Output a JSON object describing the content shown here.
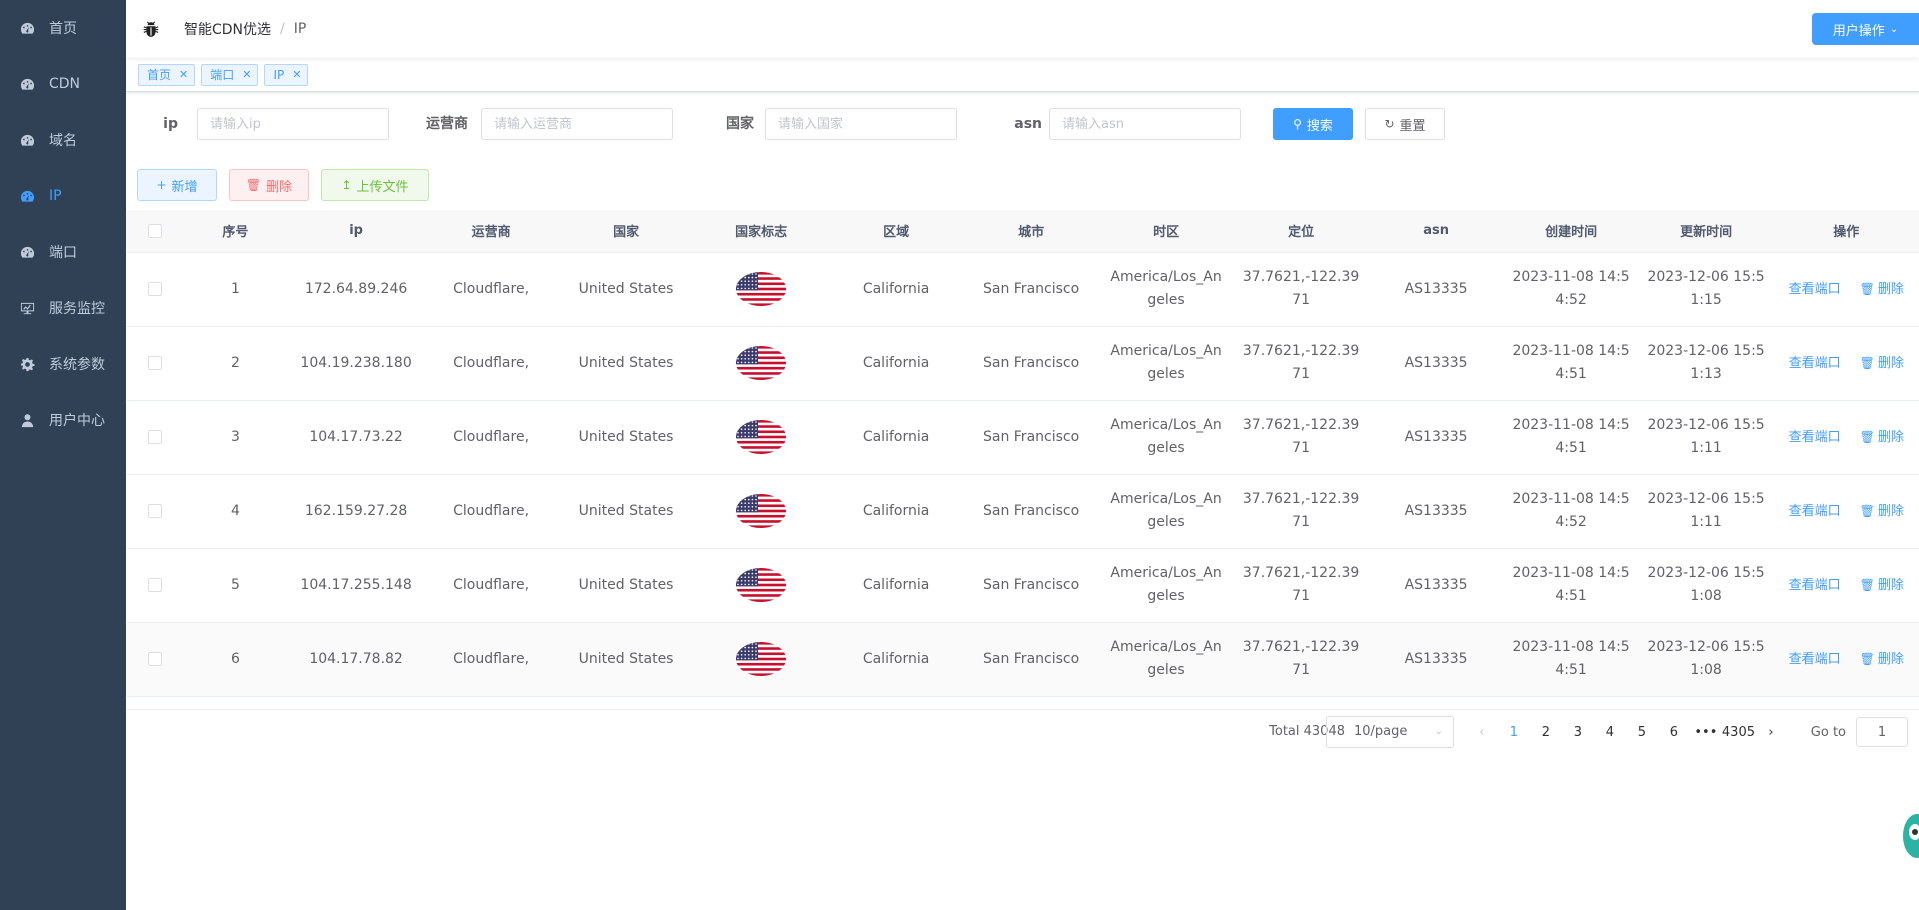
{
  "sidebar": {
    "items": [
      {
        "label": "首页",
        "icon": "dashboard-icon"
      },
      {
        "label": "CDN",
        "icon": "dashboard-icon"
      },
      {
        "label": "域名",
        "icon": "dashboard-icon"
      },
      {
        "label": "IP",
        "icon": "dashboard-icon",
        "active": true
      },
      {
        "label": "端口",
        "icon": "dashboard-icon"
      },
      {
        "label": "服务监控",
        "icon": "monitor-icon"
      },
      {
        "label": "系统参数",
        "icon": "gear-icon"
      },
      {
        "label": "用户中心",
        "icon": "user-icon"
      }
    ]
  },
  "navbar": {
    "breadcrumb": [
      "智能CDN优选",
      "IP"
    ],
    "user_menu": "用户操作"
  },
  "tags": [
    "首页",
    "端口",
    "IP"
  ],
  "filters": {
    "ip_label": "ip",
    "ip_placeholder": "请输入ip",
    "isp_label": "运营商",
    "isp_placeholder": "请输入运营商",
    "country_label": "国家",
    "country_placeholder": "请输入国家",
    "asn_label": "asn",
    "asn_placeholder": "请输入asn",
    "search": "搜索",
    "reset": "重置"
  },
  "actions": {
    "add": "新增",
    "delete": "删除",
    "upload": "上传文件"
  },
  "table": {
    "columns": [
      "序号",
      "ip",
      "运营商",
      "国家",
      "国家标志",
      "区域",
      "城市",
      "时区",
      "定位",
      "asn",
      "创建时间",
      "更新时间",
      "操作"
    ],
    "view_ports": "查看端口",
    "delete": "删除",
    "rows": [
      {
        "no": "1",
        "ip": "172.64.89.246",
        "isp": "Cloudflare,",
        "country": "United States",
        "region": "California",
        "city": "San Francisco",
        "tz1": "America/Los_An",
        "tz2": "geles",
        "loc1": "37.7621,-122.39",
        "loc2": "71",
        "asn": "AS13335",
        "c1": "2023-11-08 14:5",
        "c2": "4:52",
        "u1": "2023-12-06 15:5",
        "u2": "1:15"
      },
      {
        "no": "2",
        "ip": "104.19.238.180",
        "isp": "Cloudflare,",
        "country": "United States",
        "region": "California",
        "city": "San Francisco",
        "tz1": "America/Los_An",
        "tz2": "geles",
        "loc1": "37.7621,-122.39",
        "loc2": "71",
        "asn": "AS13335",
        "c1": "2023-11-08 14:5",
        "c2": "4:51",
        "u1": "2023-12-06 15:5",
        "u2": "1:13"
      },
      {
        "no": "3",
        "ip": "104.17.73.22",
        "isp": "Cloudflare,",
        "country": "United States",
        "region": "California",
        "city": "San Francisco",
        "tz1": "America/Los_An",
        "tz2": "geles",
        "loc1": "37.7621,-122.39",
        "loc2": "71",
        "asn": "AS13335",
        "c1": "2023-11-08 14:5",
        "c2": "4:51",
        "u1": "2023-12-06 15:5",
        "u2": "1:11"
      },
      {
        "no": "4",
        "ip": "162.159.27.28",
        "isp": "Cloudflare,",
        "country": "United States",
        "region": "California",
        "city": "San Francisco",
        "tz1": "America/Los_An",
        "tz2": "geles",
        "loc1": "37.7621,-122.39",
        "loc2": "71",
        "asn": "AS13335",
        "c1": "2023-11-08 14:5",
        "c2": "4:52",
        "u1": "2023-12-06 15:5",
        "u2": "1:11"
      },
      {
        "no": "5",
        "ip": "104.17.255.148",
        "isp": "Cloudflare,",
        "country": "United States",
        "region": "California",
        "city": "San Francisco",
        "tz1": "America/Los_An",
        "tz2": "geles",
        "loc1": "37.7621,-122.39",
        "loc2": "71",
        "asn": "AS13335",
        "c1": "2023-11-08 14:5",
        "c2": "4:51",
        "u1": "2023-12-06 15:5",
        "u2": "1:08"
      },
      {
        "no": "6",
        "ip": "104.17.78.82",
        "isp": "Cloudflare,",
        "country": "United States",
        "region": "California",
        "city": "San Francisco",
        "tz1": "America/Los_An",
        "tz2": "geles",
        "loc1": "37.7621,-122.39",
        "loc2": "71",
        "asn": "AS13335",
        "c1": "2023-11-08 14:5",
        "c2": "4:51",
        "u1": "2023-12-06 15:5",
        "u2": "1:08"
      }
    ]
  },
  "pagination": {
    "total": "Total 43048",
    "page_size": "10/page",
    "pages": [
      "1",
      "2",
      "3",
      "4",
      "5",
      "6"
    ],
    "ellipsis": "•••",
    "last": "4305",
    "current": "1",
    "goto_label": "Go to",
    "goto_value": "1"
  },
  "colors": {
    "sidebar_bg": "#304156",
    "accent": "#409eff",
    "danger": "#f56c6c",
    "success": "#67c23a"
  }
}
